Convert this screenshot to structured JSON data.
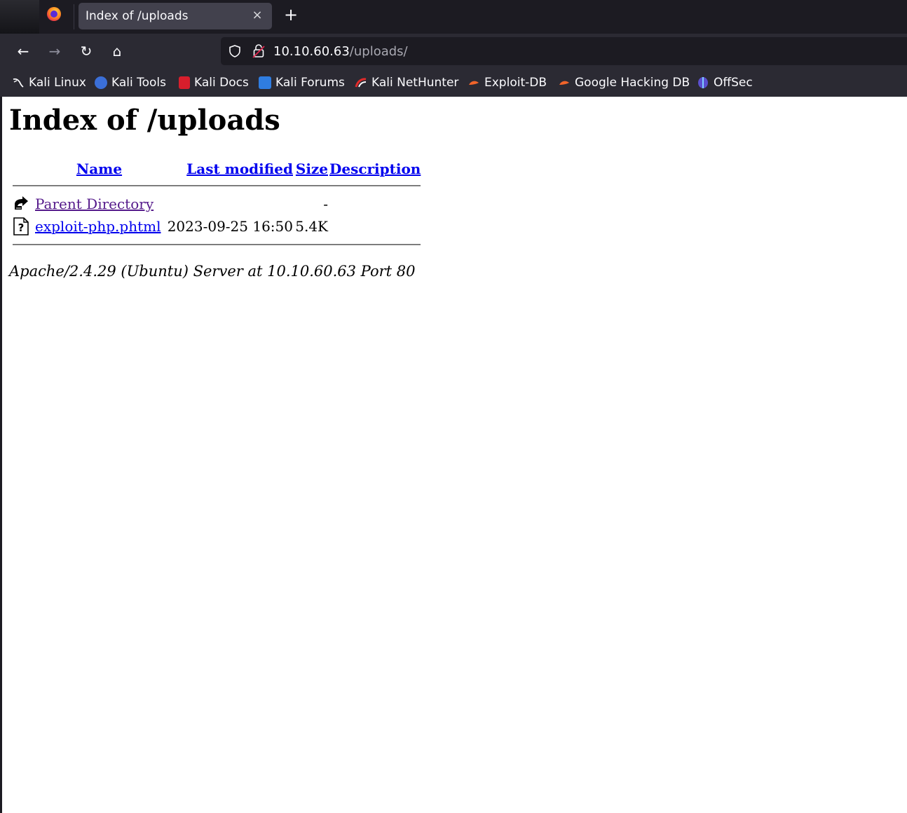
{
  "browser": {
    "tab": {
      "title": "Index of /uploads",
      "close": "×"
    },
    "new_tab": "+",
    "nav": {
      "back": "←",
      "forward": "→",
      "reload": "↻",
      "home": "⌂"
    },
    "url": {
      "host": "10.10.60.63",
      "path": "/uploads/"
    },
    "bookmarks": [
      {
        "label": "Kali Linux",
        "icon": "kali-dragon-icon",
        "color": "#1c1b22"
      },
      {
        "label": "Kali Tools",
        "icon": "kali-tools-icon",
        "color": "#3b6fd8"
      },
      {
        "label": "Kali Docs",
        "icon": "kali-docs-icon",
        "color": "#d81e2c"
      },
      {
        "label": "Kali Forums",
        "icon": "kali-forums-icon",
        "color": "#2f7de1"
      },
      {
        "label": "Kali NetHunter",
        "icon": "kali-nethunter-icon",
        "color": "#e02a2a"
      },
      {
        "label": "Exploit-DB",
        "icon": "exploit-db-icon",
        "color": "#f0642a"
      },
      {
        "label": "Google Hacking DB",
        "icon": "ghdb-icon",
        "color": "#f0642a"
      },
      {
        "label": "OffSec",
        "icon": "offsec-icon",
        "color": "#5a4fcf"
      }
    ]
  },
  "page": {
    "title": "Index of /uploads",
    "columns": {
      "name": "Name",
      "last_modified": "Last modified",
      "size": "Size",
      "description": "Description"
    },
    "rows": [
      {
        "icon": "parent-directory-icon",
        "name": "Parent Directory",
        "last_modified": "",
        "size": "-",
        "description": ""
      },
      {
        "icon": "unknown-file-icon",
        "name": "exploit-php.phtml",
        "last_modified": "2023-09-25 16:50",
        "size": "5.4K",
        "description": ""
      }
    ],
    "server_signature": "Apache/2.4.29 (Ubuntu) Server at 10.10.60.63 Port 80"
  }
}
